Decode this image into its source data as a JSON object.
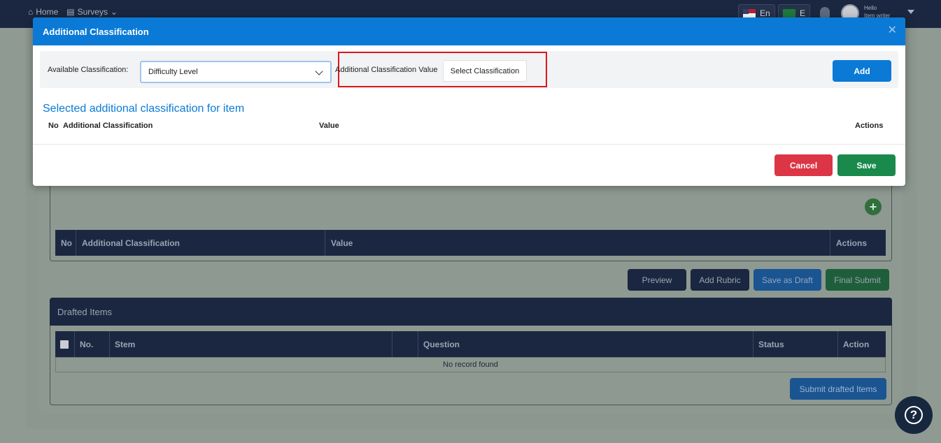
{
  "topbar": {
    "home_label": "Home",
    "surveys_label": "Surveys",
    "lang_en": "En",
    "lang_ar": "E",
    "hello_text": "Hello",
    "user_name": "Item writer"
  },
  "background": {
    "class_table_headers": [
      "No",
      "Additional Classification",
      "Value",
      "Actions"
    ],
    "action_buttons": {
      "preview": "Preview",
      "add_rubric": "Add Rubric",
      "save_draft": "Save as Draft",
      "final_submit": "Final Submit"
    },
    "drafted": {
      "title": "Drafted Items",
      "headers": [
        "No.",
        "Stem",
        "Question",
        "Status",
        "Action"
      ],
      "empty_text": "No record found",
      "submit_label": "Submit drafted Items"
    }
  },
  "modal": {
    "title": "Additional Classification",
    "available_label": "Available Classification:",
    "available_value": "Difficulty Level",
    "value_label": "Additional Classification Value",
    "select_placeholder": "Select Classification",
    "add_label": "Add",
    "section_title": "Selected additional classification for item",
    "table_headers": {
      "no": "No",
      "classification": "Additional Classification",
      "value": "Value",
      "actions": "Actions"
    },
    "cancel_label": "Cancel",
    "save_label": "Save"
  },
  "colors": {
    "primary": "#0a7ad6",
    "danger": "#dc3545",
    "success": "#198a4c",
    "navy": "#1b2740",
    "highlight": "#e0161b"
  },
  "icons": {
    "home": "home-icon",
    "surveys": "surveys-icon",
    "close": "close-icon",
    "dropdown": "chevron-down-icon",
    "help": "help-icon",
    "add": "plus-icon",
    "bell": "bell-icon"
  }
}
